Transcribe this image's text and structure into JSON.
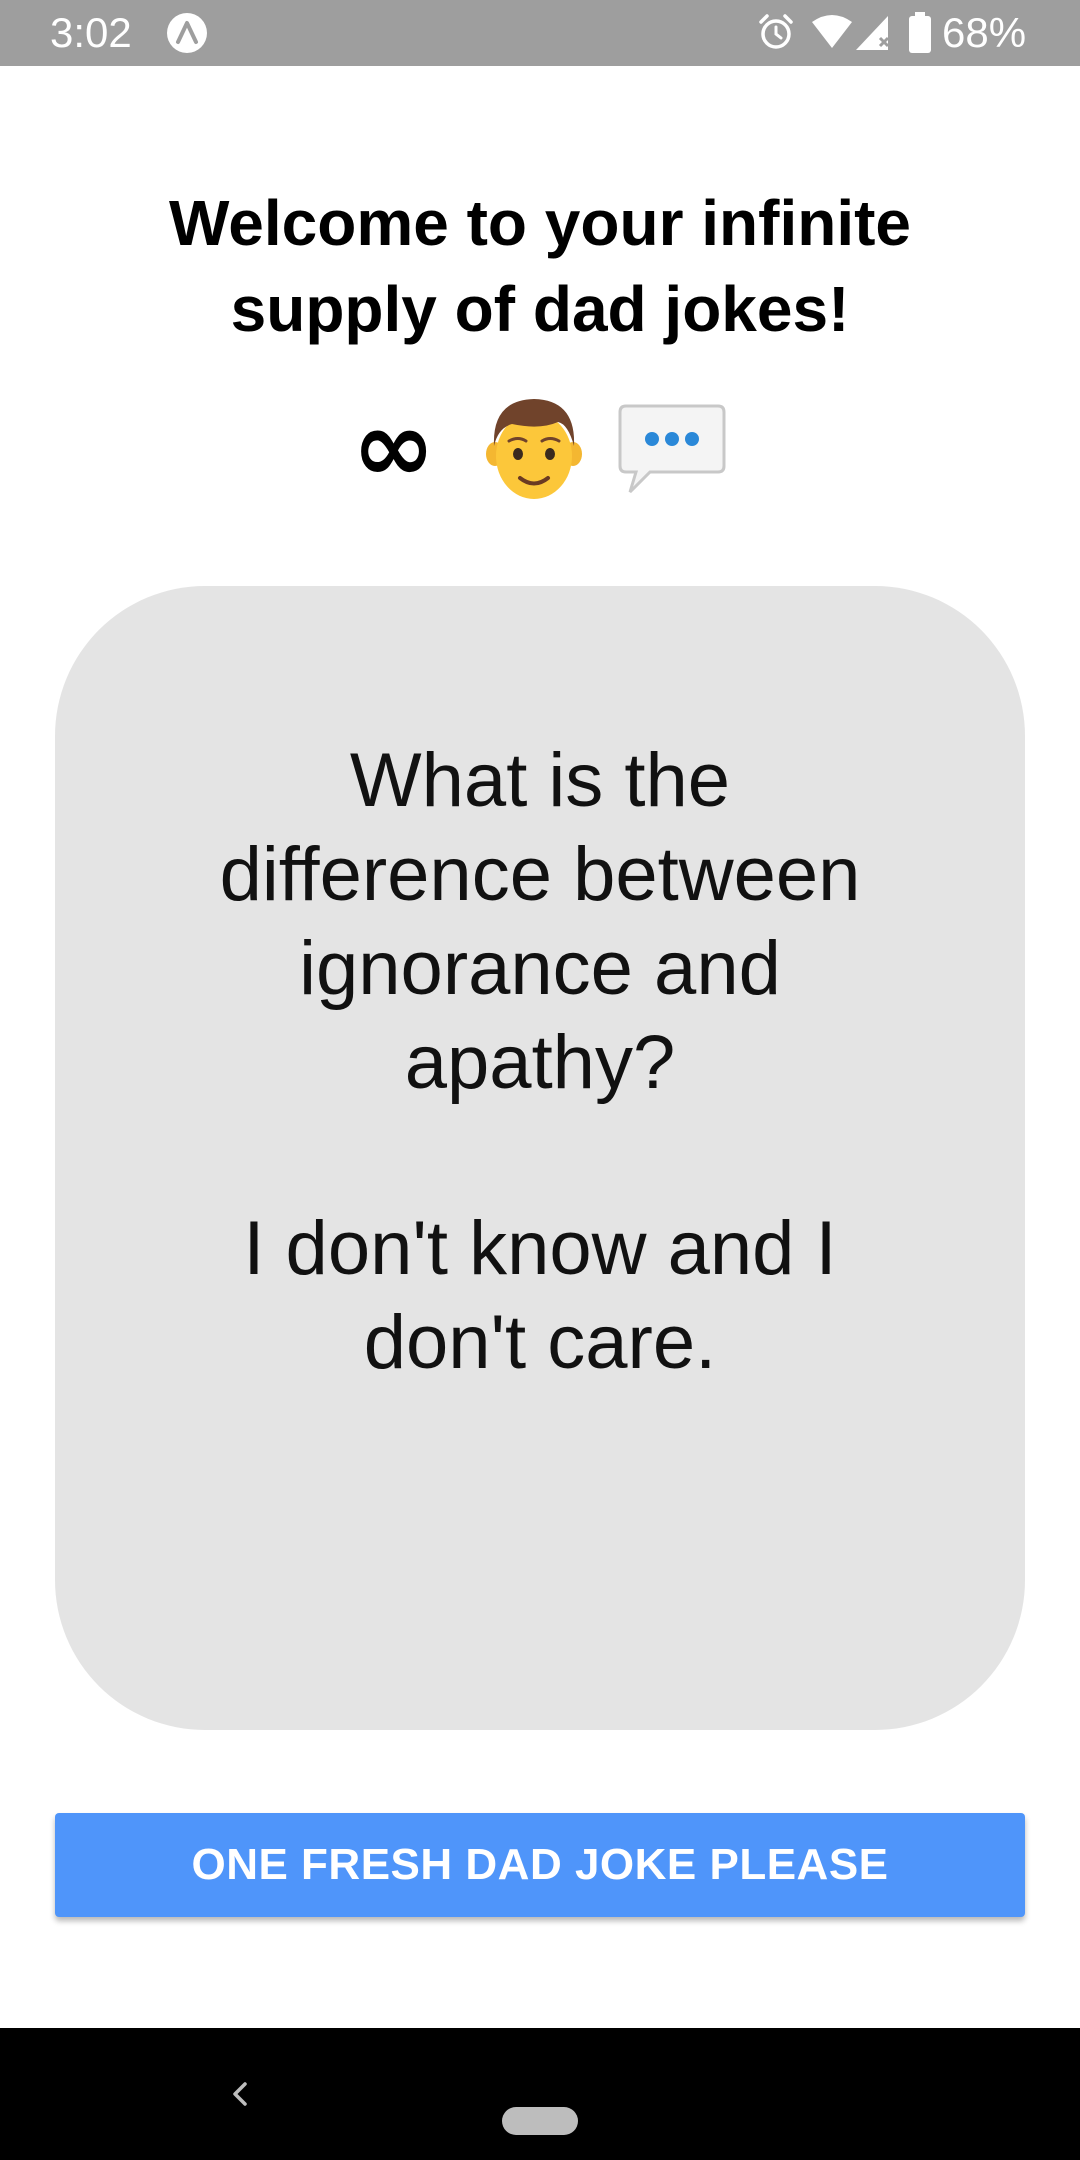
{
  "status_bar": {
    "time": "3:02",
    "battery_percent": "68%",
    "icons": [
      "app-notification-icon",
      "alarm-icon",
      "wifi-icon",
      "signal-icon",
      "battery-icon"
    ],
    "background_color": "#9e9e9e"
  },
  "header": {
    "title": "Welcome to your infinite supply of dad jokes!",
    "emoji": [
      "infinity-icon",
      "man-icon",
      "speech-bubble-icon"
    ],
    "infinity_symbol": "∞"
  },
  "joke": {
    "setup": "What is the difference between ignorance and apathy?",
    "punchline": "I don't know and I don't care.",
    "card_color": "#e4e4e4"
  },
  "actions": {
    "fresh_joke_label": "ONE FRESH DAD JOKE PLEASE",
    "button_color": "#4f95fa"
  },
  "nav_bar": {
    "icons": [
      "back-icon",
      "home-pill"
    ]
  }
}
